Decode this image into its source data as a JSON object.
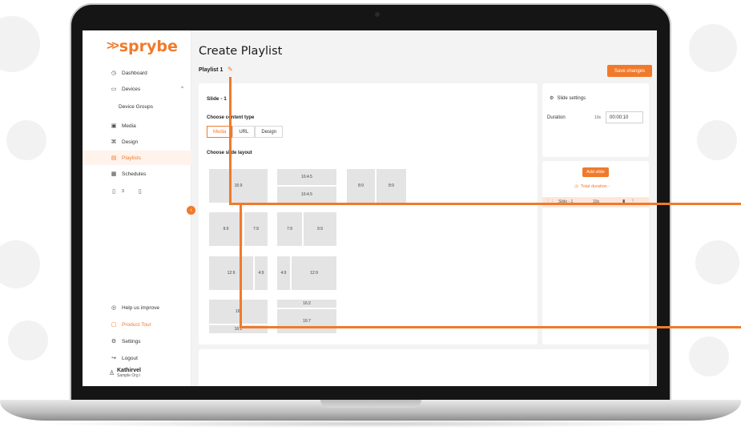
{
  "app": {
    "logo_text": "sprybe",
    "brand_color": "#f07a2a"
  },
  "sidebar": {
    "items": [
      {
        "label": "Dashboard",
        "icon": "dashboard-icon"
      },
      {
        "label": "Devices",
        "icon": "devices-icon"
      },
      {
        "label": "Device Groups",
        "icon": ""
      },
      {
        "label": "Media",
        "icon": "media-icon"
      },
      {
        "label": "Design",
        "icon": "design-icon"
      },
      {
        "label": "Playlists",
        "icon": "playlist-icon"
      },
      {
        "label": "Schedules",
        "icon": "schedule-icon"
      }
    ],
    "device_status_count": "3",
    "bottom_items": [
      {
        "label": "Help us improve",
        "icon": "help-icon"
      },
      {
        "label": "Product Tour",
        "icon": "tour-icon"
      },
      {
        "label": "Settings",
        "icon": "gear-icon"
      },
      {
        "label": "Logout",
        "icon": "logout-icon"
      }
    ],
    "user": {
      "name": "Kathirvel",
      "org": "Sample Org l"
    }
  },
  "main": {
    "title": "Create Playlist",
    "playlist_name": "Playlist 1",
    "save_label": "Save changes",
    "slide_title": "Slide - 1",
    "choose_content_type": "Choose content type",
    "content_types": [
      "Media",
      "URL",
      "Design"
    ],
    "selected_content_type": "Media",
    "choose_layout": "Choose slide layout",
    "layouts": {
      "l1": "16:9",
      "l2a": "16:4.5",
      "l2b": "16:4.5",
      "l3a": "8:9",
      "l3b": "8:9",
      "l4a": "9:9",
      "l4b": "7:9",
      "l5a": "7:9",
      "l5b": "9:9",
      "l6a": "12:9",
      "l6b": "4:9",
      "l7a": "4:9",
      "l7b": "12:9",
      "l8a": "16:",
      "l8b": "16:2",
      "l9a": "16:2",
      "l9b": "16:7"
    }
  },
  "settings": {
    "title": "Slide settings",
    "duration_label": "Duration",
    "duration_unit": "10s",
    "duration_value": "00:00:10",
    "add_slide_label": "Add slide",
    "total_duration_label": "Total duration -",
    "slide_row_label": "Slide - 1",
    "slide_row_time": "10s"
  }
}
